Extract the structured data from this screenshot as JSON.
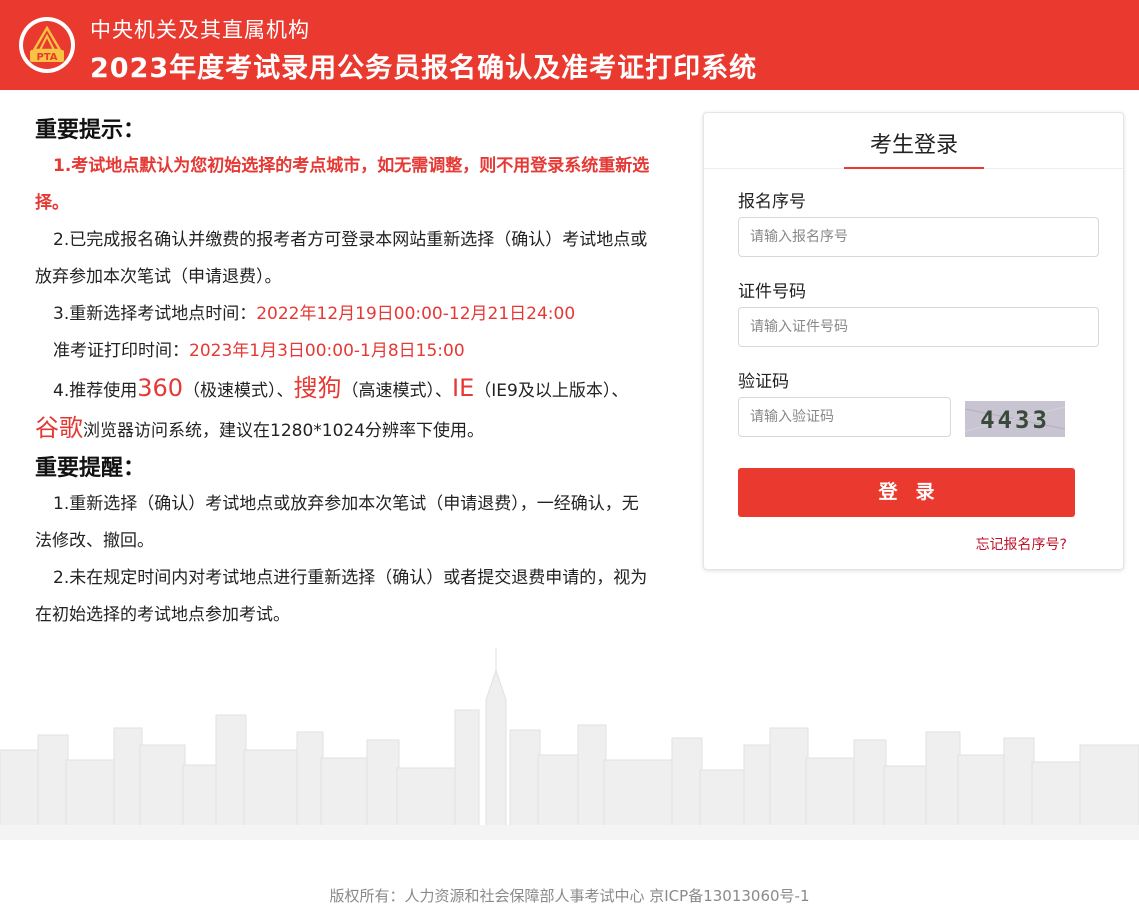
{
  "header": {
    "subtitle": "中央机关及其直属机构",
    "title": "2023年度考试录用公务员报名确认及准考证打印系统",
    "logo_text": "PTA"
  },
  "notice": {
    "heading1": "重要提示：",
    "item1": "1.考试地点默认为您初始选择的考点城市，如无需调整，则不用登录系统重新选择。",
    "item2": "2.已完成报名确认并缴费的报考者方可登录本网站重新选择（确认）考试地点或放弃参加本次笔试（申请退费）。",
    "item3_prefix": "3.重新选择考试地点时间：",
    "item3_time": "2022年12月19日00:00-12月21日24:00",
    "item3b_prefix": "准考证打印时间：",
    "item3b_time": "2023年1月3日00:00-1月8日15:00",
    "item4_a": "4.推荐使用",
    "item4_b": "360",
    "item4_c": "（极速模式）、",
    "item4_d": "搜狗",
    "item4_e": "（高速模式）、",
    "item4_f": "IE",
    "item4_g": "（IE9及以上版本）、",
    "item4_h": "谷歌",
    "item4_i": "浏览器访问系统，建议在1280*1024分辨率下使用。",
    "heading2": "重要提醒：",
    "remind1": "1.重新选择（确认）考试地点或放弃参加本次笔试（申请退费），一经确认，无法修改、撤回。",
    "remind2": "2.未在规定时间内对考试地点进行重新选择（确认）或者提交退费申请的，视为在初始选择的考试地点参加考试。"
  },
  "login": {
    "tab_label": "考生登录",
    "reg_label": "报名序号",
    "reg_placeholder": "请输入报名序号",
    "id_label": "证件号码",
    "id_placeholder": "请输入证件号码",
    "captcha_label": "验证码",
    "captcha_placeholder": "请输入验证码",
    "captcha_text": "4433",
    "button_label": "登录",
    "forgot_label": "忘记报名序号?"
  },
  "footer": {
    "text": "版权所有：人力资源和社会保障部人事考试中心 京ICP备13013060号-1"
  },
  "colors": {
    "brand_red": "#ea3a30",
    "notice_red": "#e53935"
  }
}
